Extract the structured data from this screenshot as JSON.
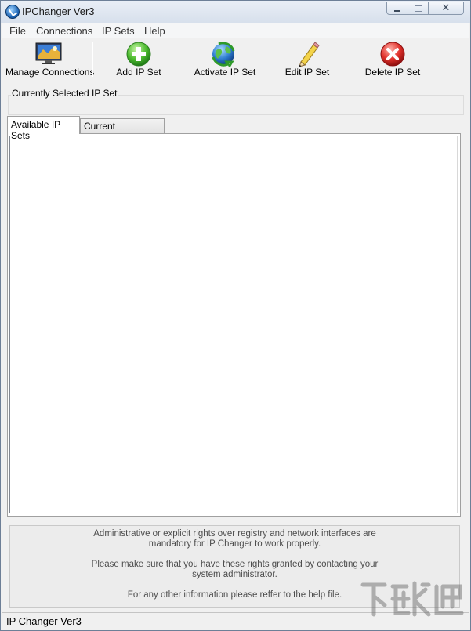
{
  "window": {
    "title": "IPChanger Ver3"
  },
  "menu": [
    "File",
    "Connections",
    "IP Sets",
    "Help"
  ],
  "toolbar": {
    "manage": {
      "label": "Manage Connections",
      "icon": "monitor-network-icon"
    },
    "add": {
      "label": "Add IP Set",
      "icon": "green-plus-icon"
    },
    "activate": {
      "label": "Activate IP Set",
      "icon": "globe-arrows-icon"
    },
    "edit": {
      "label": "Edit IP Set",
      "icon": "pencil-icon"
    },
    "delete": {
      "label": "Delete IP Set",
      "icon": "red-x-icon"
    }
  },
  "current_set": {
    "label": "Currently Selected IP Set",
    "value": ""
  },
  "tabs": [
    {
      "label": "Available IP Sets",
      "active": true
    },
    {
      "label": "Current Configuration",
      "active": false
    }
  ],
  "info": {
    "line1": "Administrative or explicit rights over registry and network interfaces are",
    "line2": "mandatory for IP Changer to work properly.",
    "line3": "Please make sure that you have these rights granted by contacting your",
    "line4": "system administrator.",
    "line5": "For any other information please reffer to the help file."
  },
  "status": {
    "text": "IP Changer Ver3"
  },
  "colors": {
    "accent_green": "#3caa2e",
    "accent_red": "#d01f1f",
    "frame": "#6d7f97"
  }
}
